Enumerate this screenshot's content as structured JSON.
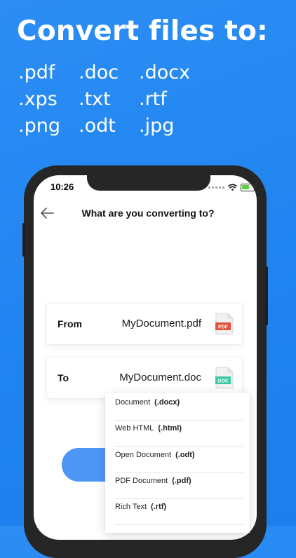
{
  "headline": "Convert files to:",
  "formats": [
    ".pdf",
    ".doc",
    ".docx",
    ".xps",
    ".txt",
    ".rtf",
    ".png",
    ".odt",
    ".jpg"
  ],
  "status_bar": {
    "time": "10:26"
  },
  "screen": {
    "title": "What are you converting to?",
    "from": {
      "label": "From",
      "filename": "MyDocument.pdf",
      "badge": "PDF",
      "icon": "pdf-file-icon",
      "color": "#e4513a"
    },
    "to": {
      "label": "To",
      "filename": "MyDocument.doc",
      "badge": "DOC",
      "icon": "doc-file-icon",
      "color": "#3cc9a2"
    }
  },
  "dropdown": {
    "items": [
      {
        "name": "Document",
        "ext": "(.docx)"
      },
      {
        "name": "Web HTML",
        "ext": "(.html)"
      },
      {
        "name": "Open Document",
        "ext": "(.odt)"
      },
      {
        "name": "PDF Document",
        "ext": "(.pdf)"
      },
      {
        "name": "Rich Text",
        "ext": "(.rtf)"
      }
    ]
  },
  "colors": {
    "background": "#2088f2",
    "accent": "#4f97f6"
  }
}
